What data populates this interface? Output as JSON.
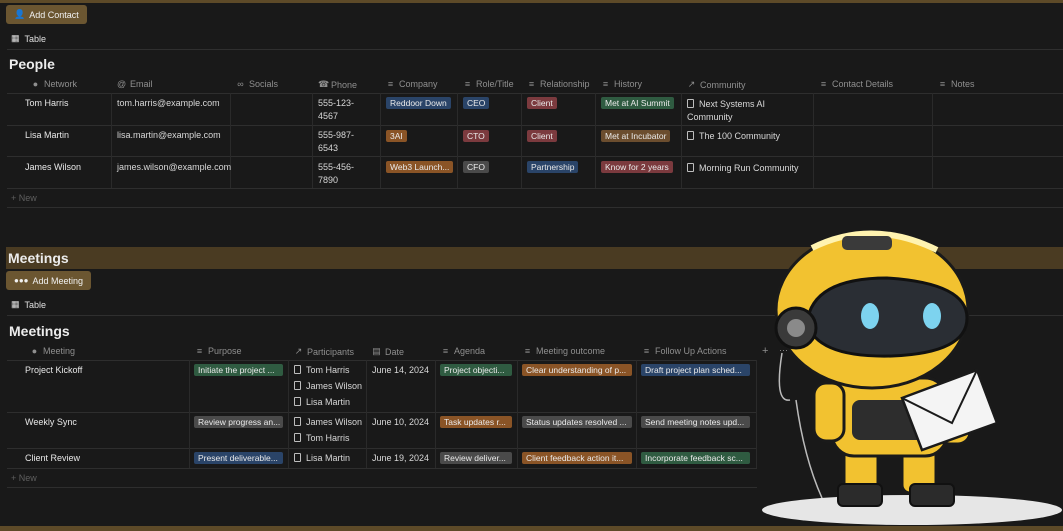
{
  "people_section": {
    "add_button": "Add Contact",
    "view_label": "Table",
    "title": "People",
    "columns": [
      "Network",
      "Email",
      "Socials",
      "Phone",
      "Company",
      "Role/Title",
      "Relationship",
      "History",
      "Community",
      "Contact Details",
      "Notes"
    ],
    "rows": [
      {
        "name": "Tom Harris",
        "email": "tom.harris@example.com",
        "phone_1": "555-123-",
        "phone_2": "4567",
        "company": "Reddoor Down",
        "role": "CEO",
        "relationship": "Client",
        "history": "Met at AI Summit",
        "community_1": "Next Systems AI",
        "community_2": "Community"
      },
      {
        "name": "Lisa Martin",
        "email": "lisa.martin@example.com",
        "phone_1": "555-987-",
        "phone_2": "6543",
        "company": "3AI",
        "role": "CTO",
        "relationship": "Client",
        "history": "Met at Incubator",
        "community_1": "The 100 Community",
        "community_2": ""
      },
      {
        "name": "James Wilson",
        "email": "james.wilson@example.com",
        "phone_1": "555-456-",
        "phone_2": "7890",
        "company": "Web3 Launch...",
        "role": "CFO",
        "relationship": "Partnership",
        "history": "Know for 2 years",
        "community_1": "Morning Run Community",
        "community_2": ""
      }
    ],
    "new_label": "+ New"
  },
  "meetings_section": {
    "band_title": "Meetings",
    "add_button": "Add Meeting",
    "view_label": "Table",
    "title": "Meetings",
    "columns": [
      "Meeting",
      "Purpose",
      "Participants",
      "Date",
      "Agenda",
      "Meeting outcome",
      "Follow Up Actions"
    ],
    "rows": [
      {
        "name": "Project Kickoff",
        "purpose": "Initiate the project ...",
        "participants": [
          "Tom Harris",
          "James Wilson",
          "Lisa Martin"
        ],
        "date": "June 14, 2024",
        "agenda": "Project objecti...",
        "outcome": "Clear understanding of p...",
        "follow_up": "Draft project plan sched..."
      },
      {
        "name": "Weekly Sync",
        "purpose": "Review progress an...",
        "participants": [
          "James Wilson",
          "Tom Harris"
        ],
        "date": "June 10, 2024",
        "agenda": "Task updates r...",
        "outcome": "Status updates resolved ...",
        "follow_up": "Send meeting notes upd..."
      },
      {
        "name": "Client Review",
        "purpose": "Present deliverable...",
        "participants": [
          "Lisa Martin"
        ],
        "date": "June 19, 2024",
        "agenda": "Review deliver...",
        "outcome": "Client feedback action it...",
        "follow_up": "Incorporate feedback sc..."
      }
    ],
    "new_label": "+ New"
  },
  "icons": {
    "network": "person-icon",
    "email": "at-icon",
    "socials": "link-icon",
    "phone": "phone-icon",
    "list": "list-icon",
    "arrow": "arrow-up-right-icon",
    "calendar": "calendar-icon",
    "table": "table-icon"
  },
  "colors": {
    "accent_band": "#4a3b22",
    "button": "#6b5631",
    "background": "#191919"
  }
}
